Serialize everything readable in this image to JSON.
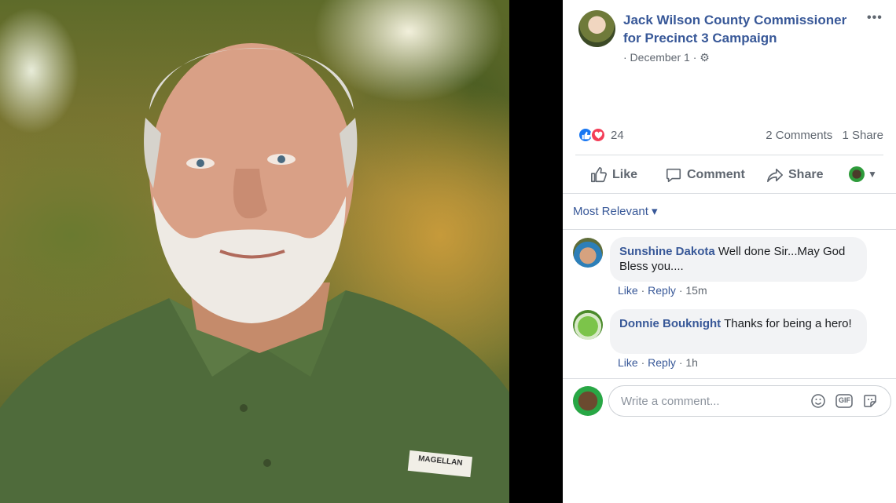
{
  "post": {
    "page_name": "Jack Wilson County Commissioner for Precinct 3 Campaign",
    "date_text": "· December 1 ·",
    "more_label": "•••",
    "reaction_count": "24",
    "comments_count": "2 Comments",
    "shares_count": "1 Share",
    "photo_badge": "MAGELLAN"
  },
  "actions": {
    "like_label": "Like",
    "comment_label": "Comment",
    "share_label": "Share"
  },
  "filter": {
    "label": "Most Relevant ▾"
  },
  "comments": [
    {
      "author": "Sunshine Dakota",
      "text": "Well done Sir...May God Bless you....",
      "like": "Like",
      "reply": "Reply",
      "time": "15m"
    },
    {
      "author": "Donnie Bouknight",
      "text": "Thanks for being a hero!",
      "like": "Like",
      "reply": "Reply",
      "time": "1h"
    }
  ],
  "composer": {
    "placeholder": "Write a comment...",
    "gif_label": "GIF"
  },
  "icons": [
    "gear-icon",
    "like-reaction-icon",
    "love-reaction-icon",
    "thumbs-up-icon",
    "comment-icon",
    "share-icon",
    "emoji-icon",
    "gif-icon",
    "sticker-icon"
  ],
  "colors": {
    "link": "#385898",
    "muted": "#606770",
    "like_blue": "#1877f2",
    "love_red": "#f33e58"
  }
}
